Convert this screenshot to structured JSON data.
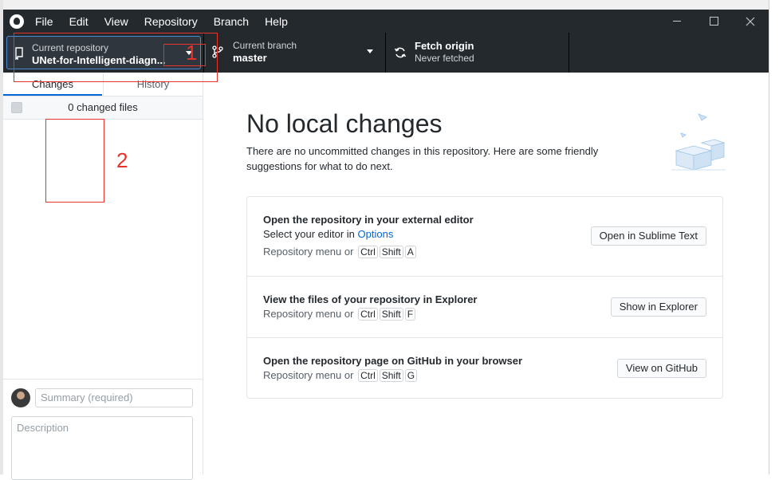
{
  "menu": {
    "file": "File",
    "edit": "Edit",
    "view": "View",
    "repository": "Repository",
    "branch": "Branch",
    "help": "Help"
  },
  "toolbar": {
    "repo_title": "Current repository",
    "repo_value": "UNet-for-Intelligent-diagn...",
    "branch_title": "Current branch",
    "branch_value": "master",
    "fetch_title": "Fetch origin",
    "fetch_value": "Never fetched"
  },
  "sidebar": {
    "tab_changes": "Changes",
    "tab_history": "History",
    "changed_count": "0 changed files",
    "summary_placeholder": "Summary (required)",
    "description_placeholder": "Description"
  },
  "main": {
    "title": "No local changes",
    "description": "There are no uncommitted changes in this repository. Here are some friendly suggestions for what to do next.",
    "suggestions": [
      {
        "title": "Open the repository in your external editor",
        "sub_prefix": "Select your editor in ",
        "sub_link": "Options",
        "shortcut_prefix": "Repository menu or",
        "keys": [
          "Ctrl",
          "Shift",
          "A"
        ],
        "button": "Open in Sublime Text"
      },
      {
        "title": "View the files of your repository in Explorer",
        "shortcut_prefix": "Repository menu or",
        "keys": [
          "Ctrl",
          "Shift",
          "F"
        ],
        "button": "Show in Explorer"
      },
      {
        "title": "Open the repository page on GitHub in your browser",
        "shortcut_prefix": "Repository menu or",
        "keys": [
          "Ctrl",
          "Shift",
          "G"
        ],
        "button": "View on GitHub"
      }
    ]
  },
  "annotations": {
    "label_1": "1",
    "label_2": "2",
    "color": "#e8322c"
  },
  "colors": {
    "titlebar": "#24292e",
    "accent": "#0366d6",
    "focus_border": "#4c8bd6"
  }
}
